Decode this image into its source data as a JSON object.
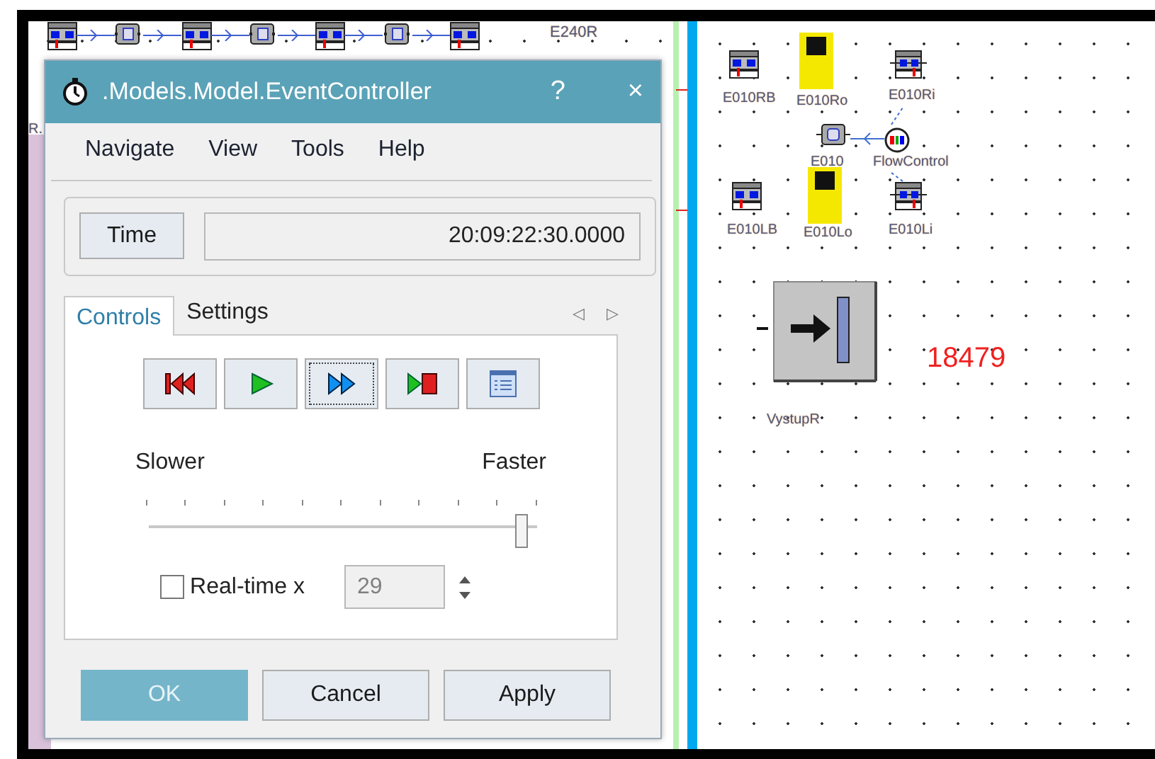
{
  "left_canvas": {
    "top_nodes": [
      {
        "kind": "station"
      },
      {
        "kind": "buffer"
      },
      {
        "kind": "station"
      },
      {
        "kind": "buffer"
      },
      {
        "kind": "station"
      },
      {
        "kind": "buffer"
      },
      {
        "kind": "station"
      }
    ],
    "labels": [
      "E240R",
      "R."
    ]
  },
  "dialog": {
    "title": ".Models.Model.EventController",
    "help": "?",
    "close": "×",
    "menu": [
      "Navigate",
      "View",
      "Tools",
      "Help"
    ],
    "time": {
      "button": "Time",
      "value": "20:09:22:30.0000"
    },
    "tabs": [
      {
        "label": "Controls",
        "selected": true
      },
      {
        "label": "Settings",
        "selected": false
      }
    ],
    "tab_scroll": [
      "◁",
      "▷"
    ],
    "transport": [
      {
        "kind": "rewind",
        "focused": false
      },
      {
        "kind": "play",
        "focused": false
      },
      {
        "kind": "fast",
        "focused": true
      },
      {
        "kind": "stop",
        "focused": false
      },
      {
        "kind": "list",
        "focused": false
      }
    ],
    "speed": {
      "min_label": "Slower",
      "max_label": "Faster",
      "level": 0.96
    },
    "realtime": {
      "label": "Real-time x",
      "checked": false,
      "value": "29",
      "disabled": true
    },
    "buttons": [
      {
        "label": "OK",
        "default": true
      },
      {
        "label": "Cancel",
        "default": false
      },
      {
        "label": "Apply",
        "default": false
      }
    ]
  },
  "right_canvas": {
    "nodes": [
      {
        "kind": "station",
        "label": "E010RB"
      },
      {
        "kind": "gate",
        "label": "E010Ro"
      },
      {
        "kind": "conveyor",
        "label": "E010Ri"
      },
      {
        "kind": "junction",
        "label": "E010"
      },
      {
        "kind": "flow",
        "label": "FlowControl"
      },
      {
        "kind": "station",
        "label": "E010LB"
      },
      {
        "kind": "gate",
        "label": "E010Lo"
      },
      {
        "kind": "conveyor",
        "label": "E010Li"
      }
    ],
    "output": {
      "label": "VystupR"
    },
    "counter": "18479"
  }
}
